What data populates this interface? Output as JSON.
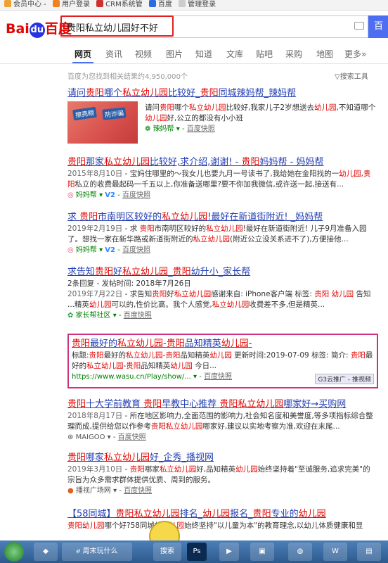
{
  "bookmarks": [
    {
      "label": "会员中心 -",
      "color": "#f0a030"
    },
    {
      "label": "用户登录",
      "color": "#f08020"
    },
    {
      "label": "CRM系统管",
      "color": "#d03030"
    },
    {
      "label": "百度",
      "color": "#2f6be0"
    },
    {
      "label": "管理登录",
      "color": "#cccccc"
    }
  ],
  "logo": {
    "text_left": "Bai",
    "paw": "du",
    "text_right": "百度"
  },
  "search": {
    "value": "贵阳私立幼儿园好不好",
    "button": "百"
  },
  "tabs": [
    "网页",
    "资讯",
    "视频",
    "图片",
    "知道",
    "文库",
    "贴吧",
    "采购",
    "地图",
    "更多»"
  ],
  "result_info": "百度为您找到相关结果约4,950,000个",
  "search_tools": "搜索工具",
  "results": [
    {
      "title": "请问贵阳哪个私立幼儿园比较好_贵阳同城辣妈帮_辣妈帮",
      "desc": "请问贵阳哪个私立幼儿园比较好,我家儿子2岁想送去幼儿园,不知道哪个幼儿园好,公立的都没有小小班",
      "source": "辣妈帮",
      "snap": "百度快照",
      "thumb_text": [
        "擦亮眼",
        "防诈骗"
      ]
    },
    {
      "title": "贵阳那家私立幼儿园比较好,求介绍,谢谢! - 贵阳妈妈帮 - 妈妈帮",
      "date": "2015年8月10日",
      "desc": "宝妈住哪里的～我女儿也要九月一号读书了,我给她在金阳找的一幼儿园,贵阳私立的收费最起码一千五以上,你准备送哪里?要不你加我微信,或许送一起,接送有...",
      "source": "妈妈帮",
      "v2": "V2",
      "snap": "百度快照"
    },
    {
      "title": "求 贵阳市南明区较好的私立幼儿园!最好在新道街附近! _妈妈帮",
      "date": "2019年2月19日",
      "desc": "求 贵阳市南明区较好的私立幼儿园!最好在新道街附近! 儿子9月准备入园了。想找一家在新华路或新道街附近的私立幼儿园(附近公立没关系进不了),方便接他...",
      "source": "妈妈帮",
      "v2": "V2",
      "snap": "百度快照"
    },
    {
      "title": "求告知贵阳好私立幼儿园_贵阳幼升小_家长帮",
      "meta": "2条回复 - 发帖时间: 2018年7月26日",
      "date": "2019年7月22日",
      "desc": "求告知贵阳好私立幼儿园感谢来自: iPhone客户端 标签: 贵阳 幼儿园 告知 ...精英幼儿园可以的,性价比高。我个人感觉,私立幼儿园收费差不多,但是精英...",
      "source": "家长帮社区",
      "snap": "百度快照"
    },
    {
      "title": "贵阳最好的私立幼儿园-贵阳品知精英幼儿园-",
      "desc": "标题:贵阳最好的私立幼儿园-贵阳品知精英幼儿园 更新时间:2019-07-09 标签: 简介: 贵阳最好的私立幼儿园-贵阳品知精英幼儿园 今日...",
      "source": "https://www.wasu.cn/Play/show/...",
      "snap": "百度快照",
      "adtag": "G3云推广 - 推视频"
    },
    {
      "title": "贵阳十大学前教育 贵阳早教中心推荐 贵阳私立幼儿园哪家好→买购网",
      "date": "2018年8月17日",
      "desc": "所在地区影响力,全面范围的影响力,社会知名度和美誉度,等多项指标综合整理而成,提供给您以作参考贵阳私立幼儿园哪家好,建议以实地考察为准,欢迎在末尾...",
      "source": "MAIGOO",
      "snap": "百度快照"
    },
    {
      "title": "贵阳哪家私立幼儿园好_企秀_播视网",
      "date": "2019年3月10日",
      "desc": "贵阳哪家私立幼儿园好,品知精英幼儿园始终坚持着\"至诚服务,追求完美\"的宗旨为众多需求群体提供优质、周到的服务。",
      "source": "播视广场网",
      "snap": "百度快照"
    },
    {
      "title": "【58同城】贵阳私立幼儿园排名_幼儿园报名_贵阳专业的幼儿园",
      "desc": "贵阳幼儿园哪个好?58同城的幼儿园始终坚持\"以儿童为本\"的教育理念,以幼儿体质健康和显",
      "source": "",
      "snap": ""
    }
  ],
  "taskbar": {
    "browser": "周末玩什么",
    "search": "搜索",
    "ps": "Ps"
  }
}
